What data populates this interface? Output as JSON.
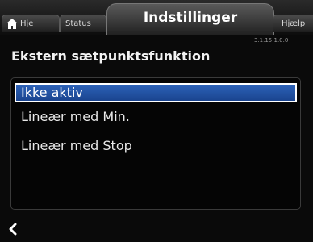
{
  "tabs": {
    "home_label": "Hje",
    "status_label": "Status",
    "active_label": "Indstillinger",
    "help_label": "Hjælp"
  },
  "version": "3.1.15.1.0.0",
  "page_title": "Ekstern sætpunktsfunktion",
  "options": [
    {
      "label": "Ikke aktiv",
      "selected": true
    },
    {
      "label": "Lineær med Min.",
      "selected": false
    },
    {
      "label": "Lineær med Stop",
      "selected": false
    }
  ],
  "icons": {
    "home": "home-icon",
    "back": "back-arrow-icon"
  },
  "colors": {
    "selection": "#2c62b8",
    "background": "#0a0a0a"
  }
}
